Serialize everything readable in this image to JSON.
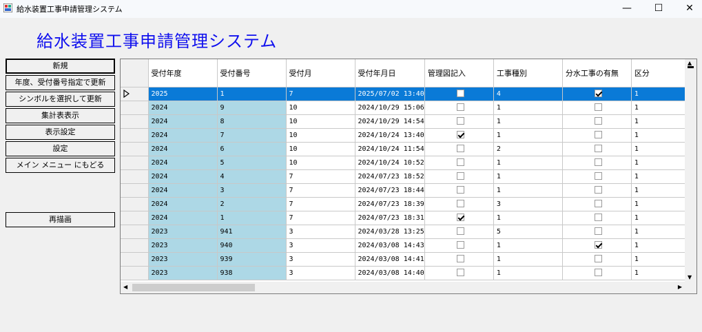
{
  "window": {
    "title": "給水装置工事申請管理システム",
    "minimize": "—",
    "maximize": "☐",
    "close": "✕"
  },
  "header": {
    "title": "給水装置工事申請管理システム"
  },
  "sidebar": {
    "buttons": [
      "新規",
      "年度、受付番号指定で更新",
      "シンボルを選択して更新",
      "集計表表示",
      "表示設定",
      "設定",
      "メイン メニュー にもどる"
    ],
    "redraw": "再描画"
  },
  "grid": {
    "columns": [
      "受付年度",
      "受付番号",
      "受付月",
      "受付年月日",
      "管理図記入",
      "工事種別",
      "分水工事の有無",
      "区分"
    ],
    "rows": [
      {
        "year": "2025",
        "no": "1",
        "month": "7",
        "date": "2025/07/02 13:40",
        "kanri": false,
        "kind": "4",
        "bunsui": true,
        "kubun": "1",
        "selected": true
      },
      {
        "year": "2024",
        "no": "9",
        "month": "10",
        "date": "2024/10/29 15:06",
        "kanri": false,
        "kind": "1",
        "bunsui": false,
        "kubun": "1"
      },
      {
        "year": "2024",
        "no": "8",
        "month": "10",
        "date": "2024/10/29 14:54",
        "kanri": false,
        "kind": "1",
        "bunsui": false,
        "kubun": "1"
      },
      {
        "year": "2024",
        "no": "7",
        "month": "10",
        "date": "2024/10/24 13:40",
        "kanri": true,
        "kind": "1",
        "bunsui": false,
        "kubun": "1"
      },
      {
        "year": "2024",
        "no": "6",
        "month": "10",
        "date": "2024/10/24 11:54",
        "kanri": false,
        "kind": "2",
        "bunsui": false,
        "kubun": "1"
      },
      {
        "year": "2024",
        "no": "5",
        "month": "10",
        "date": "2024/10/24 10:52",
        "kanri": false,
        "kind": "1",
        "bunsui": false,
        "kubun": "1"
      },
      {
        "year": "2024",
        "no": "4",
        "month": "7",
        "date": "2024/07/23 18:52",
        "kanri": false,
        "kind": "1",
        "bunsui": false,
        "kubun": "1"
      },
      {
        "year": "2024",
        "no": "3",
        "month": "7",
        "date": "2024/07/23 18:44",
        "kanri": false,
        "kind": "1",
        "bunsui": false,
        "kubun": "1"
      },
      {
        "year": "2024",
        "no": "2",
        "month": "7",
        "date": "2024/07/23 18:39",
        "kanri": false,
        "kind": "3",
        "bunsui": false,
        "kubun": "1"
      },
      {
        "year": "2024",
        "no": "1",
        "month": "7",
        "date": "2024/07/23 18:31",
        "kanri": true,
        "kind": "1",
        "bunsui": false,
        "kubun": "1"
      },
      {
        "year": "2023",
        "no": "941",
        "month": "3",
        "date": "2024/03/28 13:25",
        "kanri": false,
        "kind": "5",
        "bunsui": false,
        "kubun": "1"
      },
      {
        "year": "2023",
        "no": "940",
        "month": "3",
        "date": "2024/03/08 14:43",
        "kanri": false,
        "kind": "1",
        "bunsui": true,
        "kubun": "1"
      },
      {
        "year": "2023",
        "no": "939",
        "month": "3",
        "date": "2024/03/08 14:41",
        "kanri": false,
        "kind": "1",
        "bunsui": false,
        "kubun": "1"
      },
      {
        "year": "2023",
        "no": "938",
        "month": "3",
        "date": "2024/03/08 14:40",
        "kanri": false,
        "kind": "1",
        "bunsui": false,
        "kubun": "1"
      }
    ]
  },
  "colors": {
    "selected_row": "#0a7ad7",
    "number_column": "#add8e6",
    "title": "#1010ee"
  },
  "icons": {
    "row_pointer": "triangle-right-icon"
  }
}
